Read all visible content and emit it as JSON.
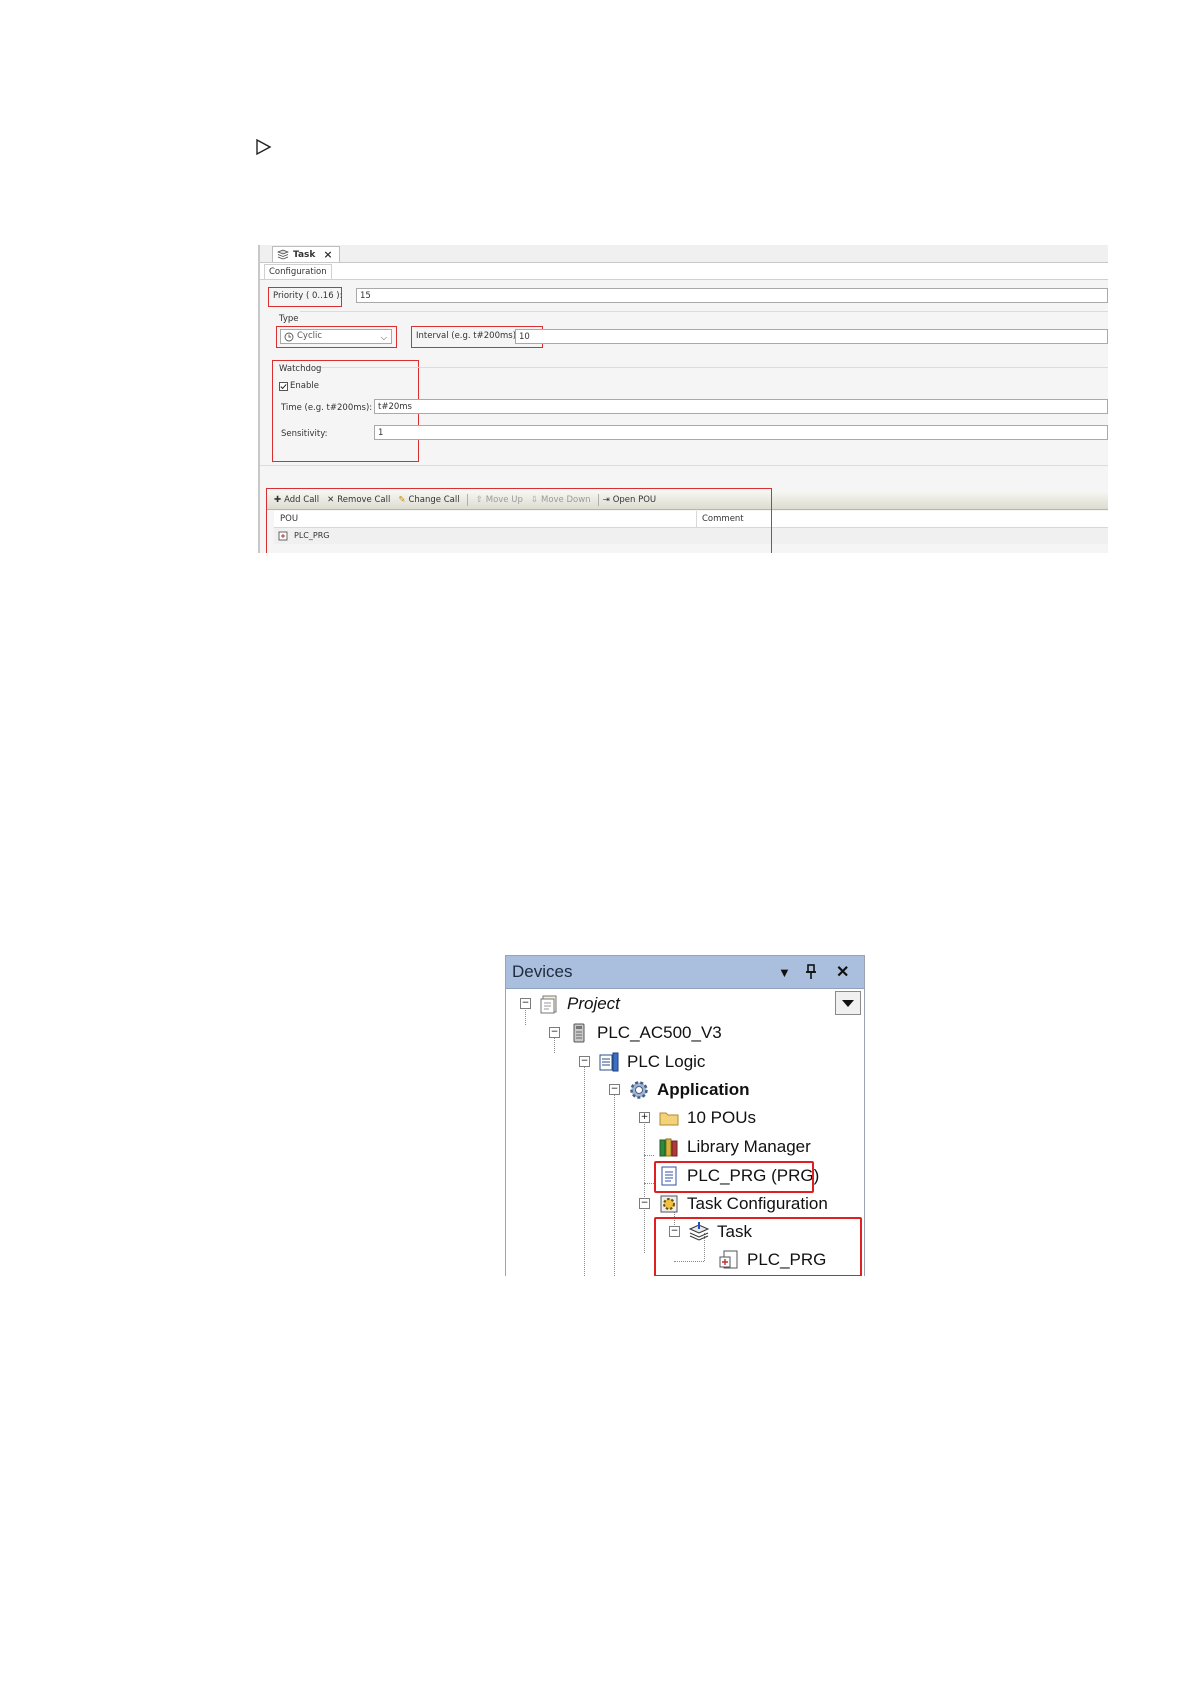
{
  "task_editor": {
    "tab_label": "Task",
    "close_glyph": "×",
    "subtab_label": "Configuration",
    "priority": {
      "label": "Priority ( 0..16 ):",
      "value": "15"
    },
    "type": {
      "label": "Type",
      "selected": "Cyclic"
    },
    "interval": {
      "label": "Interval (e.g. t#200ms):",
      "value": "10"
    },
    "watchdog": {
      "label": "Watchdog",
      "enable_label": "Enable",
      "enabled": true,
      "time_label": "Time (e.g. t#200ms):",
      "time_value": "t#20ms",
      "sensitivity_label": "Sensitivity:",
      "sensitivity_value": "1"
    },
    "toolbar": {
      "add_call": "Add Call",
      "remove_call": "Remove Call",
      "change_call": "Change Call",
      "move_up": "Move Up",
      "move_down": "Move Down",
      "open_pou": "Open POU"
    },
    "grid": {
      "columns": [
        "POU",
        "Comment"
      ],
      "rows": [
        {
          "pou": "PLC_PRG",
          "comment": ""
        }
      ]
    },
    "highlight_color": "#d83030"
  },
  "devices": {
    "title": "Devices",
    "icons": {
      "menu": "▼",
      "pin": "📌",
      "close": "✕"
    },
    "tree": [
      {
        "label": "Project",
        "icon": "project-icon"
      },
      {
        "label": "PLC_AC500_V3",
        "icon": "device-icon"
      },
      {
        "label": "PLC Logic",
        "icon": "plc-logic-icon"
      },
      {
        "label": "Application",
        "icon": "application-gear-icon"
      },
      {
        "label": "10 POUs",
        "icon": "folder-icon"
      },
      {
        "label": "Library Manager",
        "icon": "library-icon"
      },
      {
        "label": "PLC_PRG (PRG)",
        "icon": "program-icon"
      },
      {
        "label": "Task Configuration",
        "icon": "task-config-icon"
      },
      {
        "label": "Task",
        "icon": "task-icon"
      },
      {
        "label": "PLC_PRG",
        "icon": "program-call-icon"
      }
    ],
    "highlight_color": "#e02020"
  }
}
